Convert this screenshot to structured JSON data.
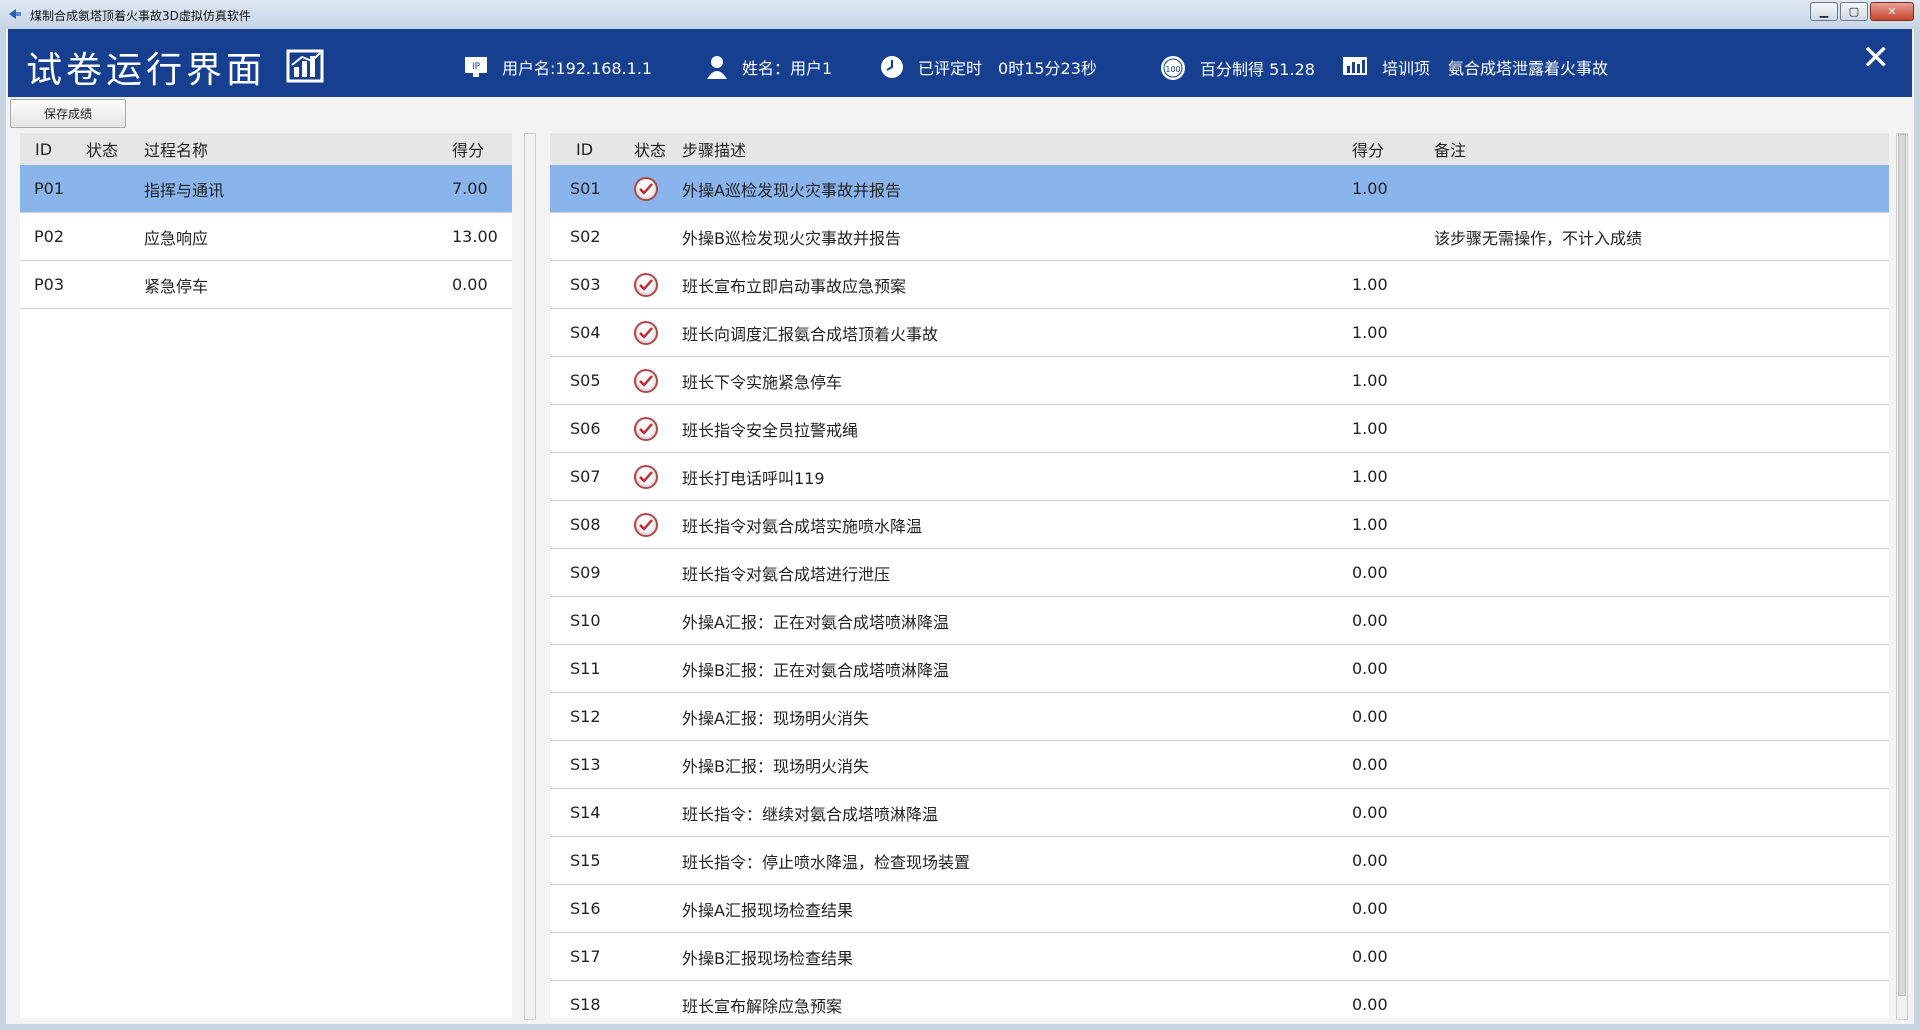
{
  "window": {
    "title": "煤制合成氨塔顶着火事故3D虚拟仿真软件"
  },
  "header": {
    "page_title": "试卷运行界面",
    "ip_icon_label": "IP",
    "username": "用户名:192.168.1.1",
    "name": "姓名：用户1",
    "elapsed_label": "已评定时",
    "elapsed_value": "0时15分23秒",
    "score_icon_label": "100",
    "score": "百分制得 51.28",
    "training_label": "培训项",
    "training_value": "氨合成塔泄露着火事故"
  },
  "toolbar": {
    "save_label": "保存成绩"
  },
  "process_table": {
    "headers": {
      "id": "ID",
      "status": "状态",
      "name": "过程名称",
      "score": "得分"
    },
    "rows": [
      {
        "id": "P01",
        "status": "green",
        "name": "指挥与通讯",
        "score": "7.00",
        "selected": true
      },
      {
        "id": "P02",
        "status": "green",
        "name": "应急响应",
        "score": "13.00",
        "selected": false
      },
      {
        "id": "P03",
        "status": "green",
        "name": "紧急停车",
        "score": "0.00",
        "selected": false
      }
    ]
  },
  "step_table": {
    "headers": {
      "id": "ID",
      "status": "状态",
      "desc": "步骤描述",
      "score": "得分",
      "note": "备注"
    },
    "rows": [
      {
        "id": "S01",
        "status": "check",
        "desc": "外操A巡检发现火灾事故并报告",
        "score": "1.00",
        "note": "",
        "selected": true
      },
      {
        "id": "S02",
        "status": "none",
        "desc": "外操B巡检发现火灾事故并报告",
        "score": "",
        "note": "该步骤无需操作，不计入成绩",
        "selected": false
      },
      {
        "id": "S03",
        "status": "check",
        "desc": "班长宣布立即启动事故应急预案",
        "score": "1.00",
        "note": ""
      },
      {
        "id": "S04",
        "status": "check",
        "desc": "班长向调度汇报氨合成塔顶着火事故",
        "score": "1.00",
        "note": ""
      },
      {
        "id": "S05",
        "status": "check",
        "desc": "班长下令实施紧急停车",
        "score": "1.00",
        "note": ""
      },
      {
        "id": "S06",
        "status": "check",
        "desc": "班长指令安全员拉警戒绳",
        "score": "1.00",
        "note": ""
      },
      {
        "id": "S07",
        "status": "check",
        "desc": "班长打电话呼叫119",
        "score": "1.00",
        "note": ""
      },
      {
        "id": "S08",
        "status": "check",
        "desc": "班长指令对氨合成塔实施喷水降温",
        "score": "1.00",
        "note": ""
      },
      {
        "id": "S09",
        "status": "blue",
        "desc": "班长指令对氨合成塔进行泄压",
        "score": "0.00",
        "note": ""
      },
      {
        "id": "S10",
        "status": "blue",
        "desc": "外操A汇报：正在对氨合成塔喷淋降温",
        "score": "0.00",
        "note": ""
      },
      {
        "id": "S11",
        "status": "blue",
        "desc": "外操B汇报：正在对氨合成塔喷淋降温",
        "score": "0.00",
        "note": ""
      },
      {
        "id": "S12",
        "status": "blue",
        "desc": "外操A汇报：现场明火消失",
        "score": "0.00",
        "note": ""
      },
      {
        "id": "S13",
        "status": "blue",
        "desc": "外操B汇报：现场明火消失",
        "score": "0.00",
        "note": ""
      },
      {
        "id": "S14",
        "status": "blue",
        "desc": "班长指令：继续对氨合成塔喷淋降温",
        "score": "0.00",
        "note": ""
      },
      {
        "id": "S15",
        "status": "blue",
        "desc": "班长指令：停止喷水降温，检查现场装置",
        "score": "0.00",
        "note": ""
      },
      {
        "id": "S16",
        "status": "blue",
        "desc": "外操A汇报现场检查结果",
        "score": "0.00",
        "note": ""
      },
      {
        "id": "S17",
        "status": "blue",
        "desc": "外操B汇报现场检查结果",
        "score": "0.00",
        "note": ""
      },
      {
        "id": "S18",
        "status": "blue",
        "desc": "班长宣布解除应急预案",
        "score": "0.00",
        "note": ""
      }
    ]
  },
  "colors": {
    "header_bg": "#163f8f",
    "selected_row": "#8ab4ec",
    "table_header": "#e6e6e6"
  }
}
